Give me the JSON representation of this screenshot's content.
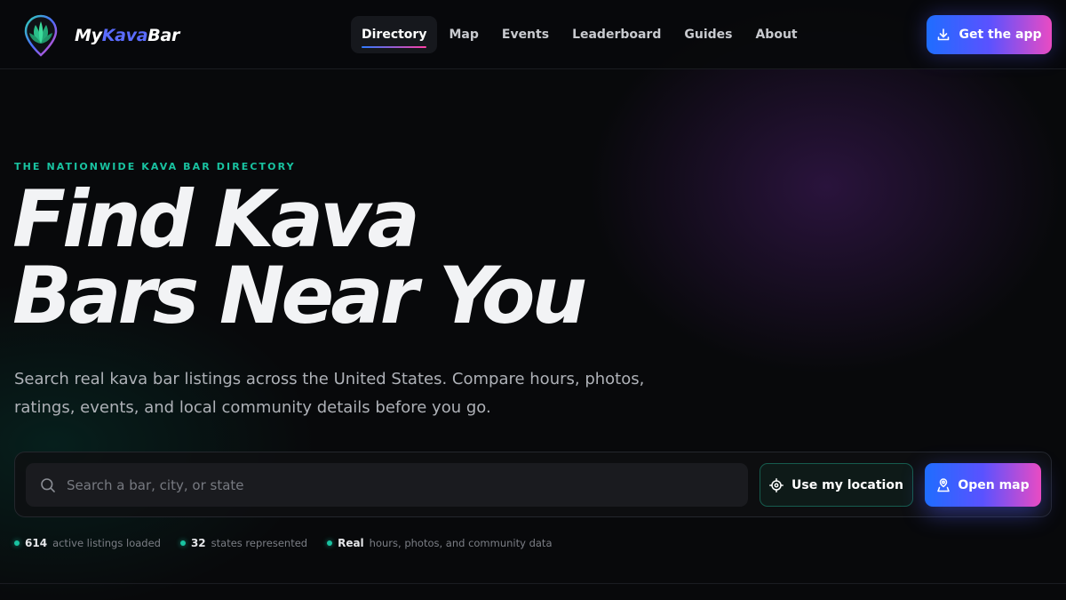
{
  "brand": {
    "name_part1": "My",
    "name_part2": "Kava",
    "name_part3": "Bar",
    "logo_icon": "kava-leaf-pin-icon",
    "colors": {
      "accent_blue": "#1f6dff",
      "accent_pink": "#e94bc3",
      "accent_teal": "#19c3a1"
    }
  },
  "nav": {
    "items": [
      {
        "label": "Directory",
        "active": true
      },
      {
        "label": "Map"
      },
      {
        "label": "Events"
      },
      {
        "label": "Leaderboard"
      },
      {
        "label": "Guides"
      },
      {
        "label": "About"
      }
    ],
    "cta": {
      "label": "Get the app",
      "icon": "download-icon"
    }
  },
  "hero": {
    "eyebrow": "THE NATIONWIDE KAVA BAR DIRECTORY",
    "title_line1": "Find Kava",
    "title_line2": "Bars Near You",
    "subtitle_line1": "Search real kava bar listings across the United States. Compare hours, photos,",
    "subtitle_line2": "ratings, events, and local community details before you go."
  },
  "search": {
    "placeholder": "Search a bar, city, or state",
    "value": "",
    "search_icon": "search-icon",
    "location_button": {
      "label": "Use my location",
      "icon": "crosshair-icon"
    },
    "map_button": {
      "label": "Open map",
      "icon": "map-pin-icon"
    }
  },
  "stats": [
    {
      "value": "614",
      "label": "active listings loaded"
    },
    {
      "value": "32",
      "label": "states represented"
    },
    {
      "value": "Real",
      "label": "hours, photos, and community data"
    }
  ]
}
